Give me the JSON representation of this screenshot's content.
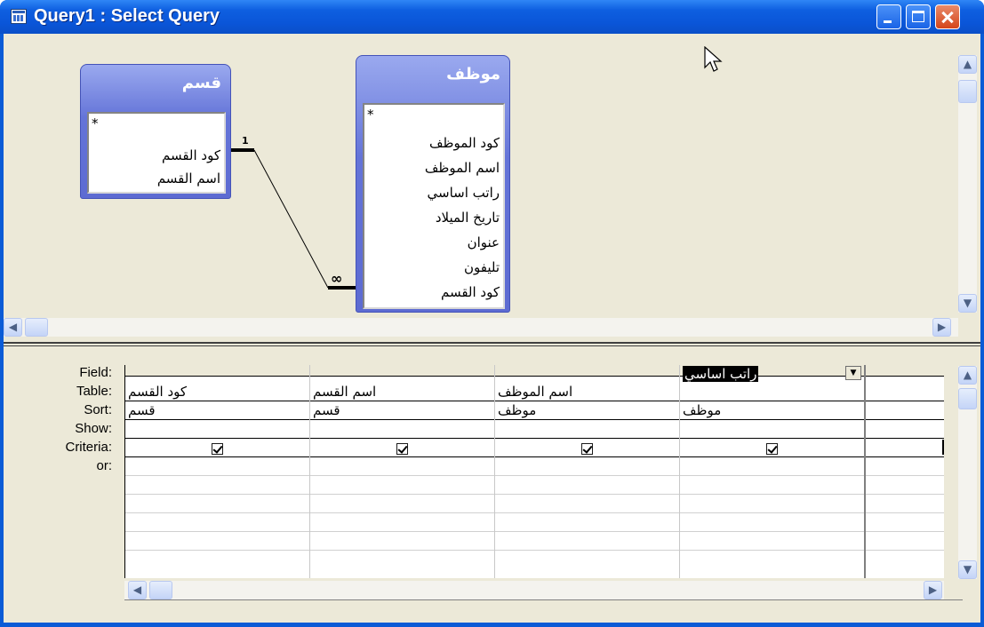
{
  "window": {
    "title": "Query1 : Select Query"
  },
  "tables": [
    {
      "name": "قسم",
      "fields": [
        "*",
        "كود القسم",
        "اسم القسم"
      ]
    },
    {
      "name": "موظف",
      "fields": [
        "*",
        "كود الموظف",
        "اسم الموظف",
        "راتب اساسي",
        "تاريخ الميلاد",
        "عنوان",
        "تليفون",
        "كود القسم"
      ]
    }
  ],
  "relationship": {
    "one_label": "1",
    "many_label": "∞"
  },
  "grid": {
    "row_labels": [
      "Field:",
      "Table:",
      "Sort:",
      "Show:",
      "Criteria:",
      "or:"
    ],
    "columns": [
      {
        "field": "كود القسم",
        "table": "قسم",
        "show": true
      },
      {
        "field": "اسم القسم",
        "table": "قسم",
        "show": true
      },
      {
        "field": "اسم الموظف",
        "table": "موظف",
        "show": true
      },
      {
        "field": "راتب اساسي",
        "table": "موظف",
        "show": true
      }
    ]
  },
  "icons": {
    "window": "query-icon",
    "minimize": "minimize-icon",
    "maximize": "maximize-icon",
    "close": "close-icon",
    "dropdown": "chevron-down-icon",
    "scroll_up": "scroll-up-arrow-icon",
    "scroll_down": "scroll-down-arrow-icon",
    "scroll_left": "scroll-left-arrow-icon",
    "scroll_right": "scroll-right-arrow-icon"
  },
  "colors": {
    "titlebar": "#0a55d8",
    "pane": "#ece9d8",
    "table_header": "#6474d8"
  }
}
